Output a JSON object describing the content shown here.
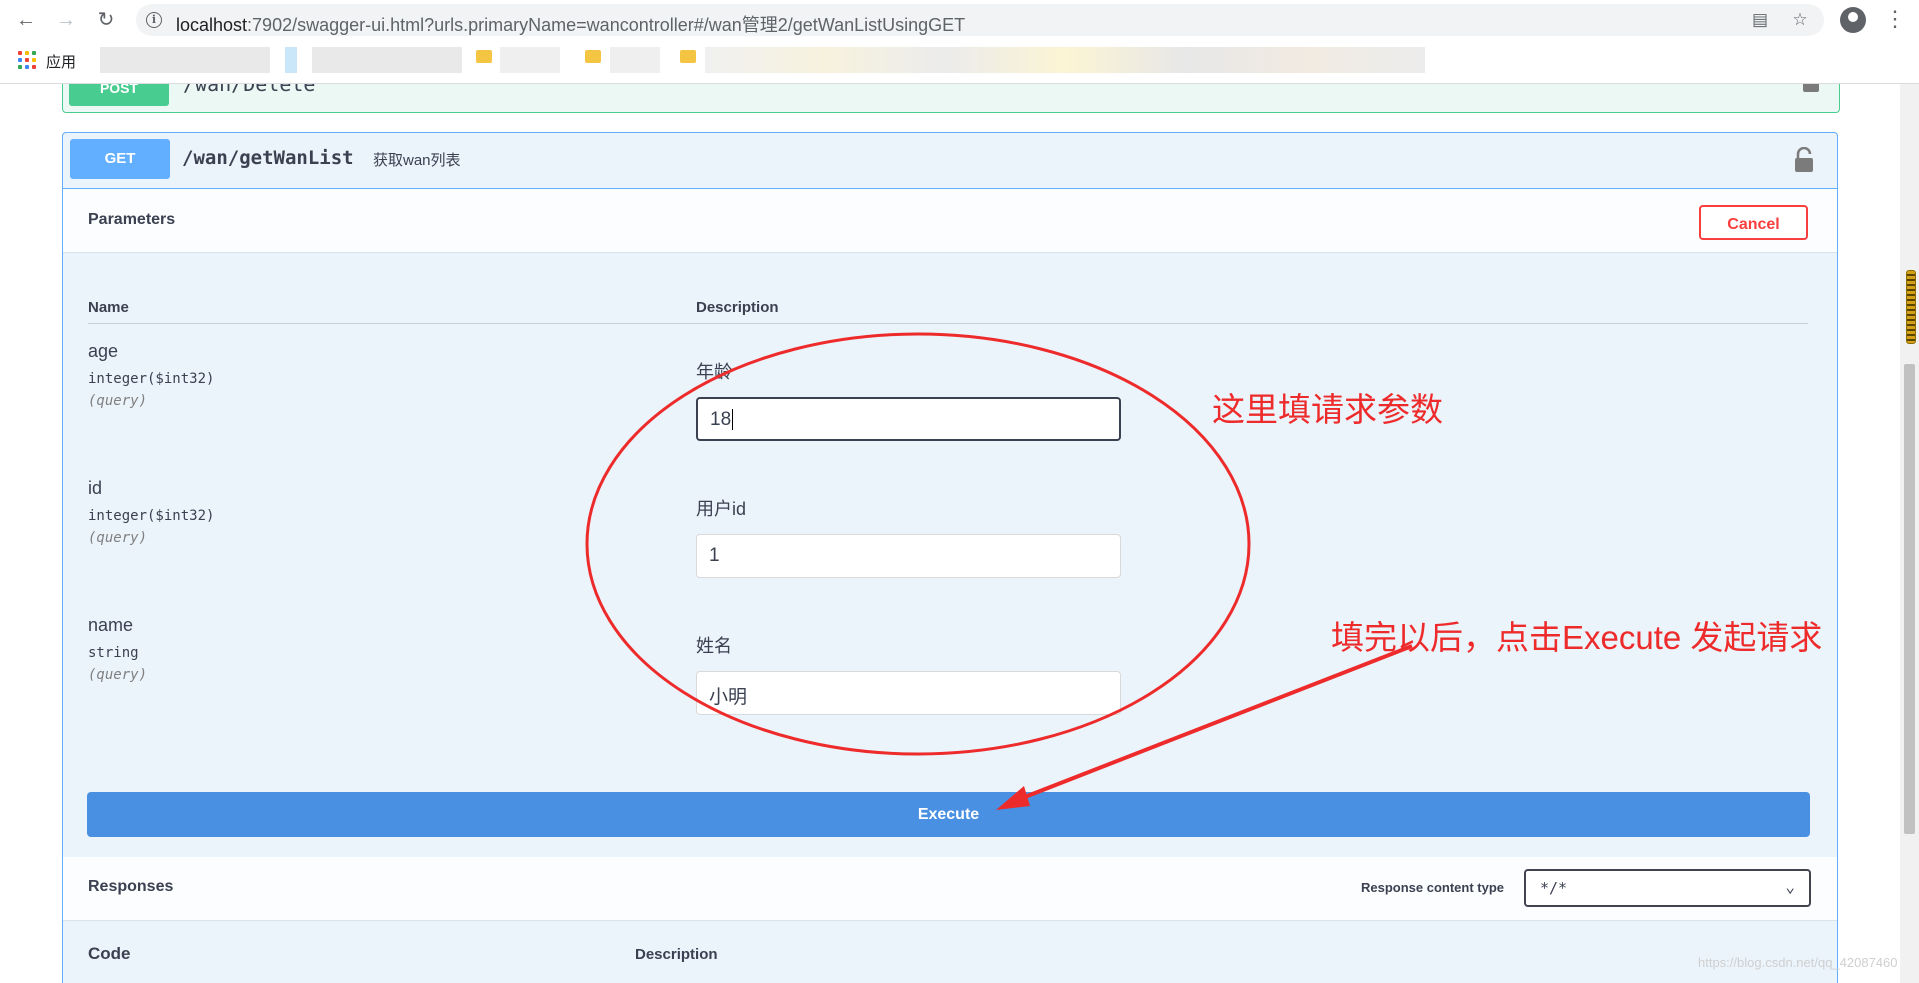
{
  "browser": {
    "url_host": "localhost",
    "url_rest": ":7902/swagger-ui.html?urls.primaryName=wancontroller#/wan管理2/getWanListUsingGET",
    "apps_label": "应用",
    "back_icon": "arrow-left-icon",
    "forward_icon": "arrow-right-icon",
    "reload_icon": "reload-icon"
  },
  "operations": {
    "post": {
      "method": "POST",
      "path": "/wan/Delete"
    },
    "get": {
      "method": "GET",
      "path": "/wan/getWanList",
      "summary": "获取wan列表"
    }
  },
  "parameters": {
    "title": "Parameters",
    "cancel_label": "Cancel",
    "col_name": "Name",
    "col_description": "Description",
    "items": [
      {
        "name": "age",
        "type": "integer($int32)",
        "in": "(query)",
        "description": "年龄",
        "value": "18"
      },
      {
        "name": "id",
        "type": "integer($int32)",
        "in": "(query)",
        "description": "用户id",
        "value": "1"
      },
      {
        "name": "name",
        "type": "string",
        "in": "(query)",
        "description": "姓名",
        "value": "小明"
      }
    ]
  },
  "execute_label": "Execute",
  "responses": {
    "title": "Responses",
    "content_type_label": "Response content type",
    "content_type_value": "*/*",
    "col_code": "Code",
    "col_description": "Description"
  },
  "annotations": {
    "fill_params": "这里填请求参数",
    "click_execute": "填完以后，点击Execute 发起请求"
  },
  "watermark": "https://blog.csdn.net/qq_42087460",
  "colors": {
    "get": "#61affe",
    "post": "#49cc90",
    "execute": "#4990e2",
    "cancel": "#f93e3e",
    "annotation": "#ee2b2b"
  }
}
